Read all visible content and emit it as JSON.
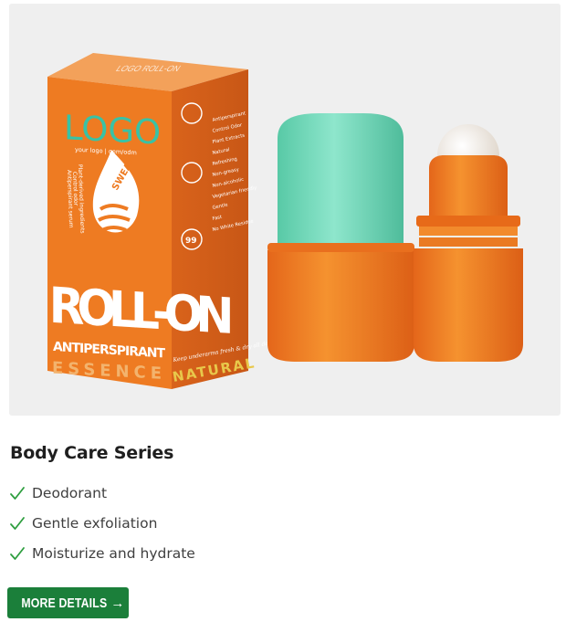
{
  "product": {
    "image_alt": "Roll-on antiperspirant essence bottles and box",
    "box": {
      "logo": "LOGO",
      "logo_sub": "your logo | oem/odm",
      "top_text": "LOGO ROLL-ON",
      "brand_line": "ROLL-ON",
      "subline": "ANTIPERSPIRANT",
      "essence": "ESSENCE",
      "natural": "NATURAL",
      "badge_sweat": "SWEAT",
      "tagline": "Keep underarms fresh & dry all day!",
      "side_text_1": "Plant-derived ingredients",
      "side_text_2": "Control odor",
      "side_text_3": "Antiperspirant serum",
      "features": [
        "Antiperspirant",
        "Control Odor",
        "Plant Extracts",
        "Natural",
        "Refreshing",
        "Non-greasy",
        "Non-alcoholic",
        "Vegetarian friendly",
        "Gentle",
        "Fast",
        "No White Residue"
      ],
      "badge_99": "99"
    },
    "colors": {
      "orange": "#ef7d1f",
      "orange_dark": "#d8661a",
      "mint": "#6fd8b8",
      "green_button": "#1b7f3a",
      "check": "#2e9e3f"
    }
  },
  "card": {
    "title": "Body Care Series",
    "features": [
      {
        "icon": "check-icon",
        "label": "Deodorant"
      },
      {
        "icon": "check-icon",
        "label": "Gentle exfoliation"
      },
      {
        "icon": "check-icon",
        "label": "Moisturize and hydrate"
      }
    ],
    "cta": {
      "label": "MORE DETAILS",
      "icon": "arrow-right-icon",
      "arrow": "→"
    }
  }
}
